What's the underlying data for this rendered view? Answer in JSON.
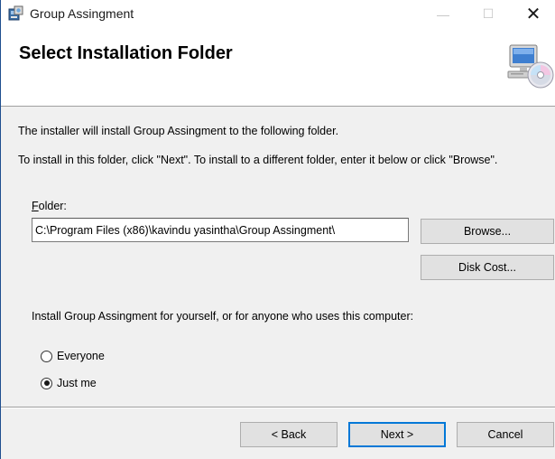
{
  "window": {
    "title": "Group Assingment",
    "controls": {
      "minimize": "—",
      "maximize": "☐",
      "close": "✕"
    }
  },
  "banner": {
    "title": "Select Installation Folder",
    "art_icon": "computer-cd-icon"
  },
  "body": {
    "line1": "The installer will install Group Assingment to the following folder.",
    "line2": "To install in this folder, click \"Next\". To install to a different folder, enter it below or click \"Browse\"."
  },
  "folder": {
    "label_accel": "F",
    "label_rest": "older:",
    "value": "C:\\Program Files (x86)\\kavindu yasintha\\Group Assingment\\",
    "browse_label": "Browse...",
    "diskcost_label": "Disk Cost..."
  },
  "install_for": {
    "prompt": "Install Group Assingment for yourself, or for anyone who uses this computer:",
    "options": [
      {
        "label": "Everyone",
        "selected": false
      },
      {
        "label": "Just me",
        "selected": true
      }
    ]
  },
  "footer": {
    "back_label": "< Back",
    "next_label": "Next >",
    "cancel_label": "Cancel"
  },
  "colors": {
    "accent": "#0078d7",
    "button_face": "#e1e1e1",
    "dialog_bg": "#f0f0f0"
  }
}
